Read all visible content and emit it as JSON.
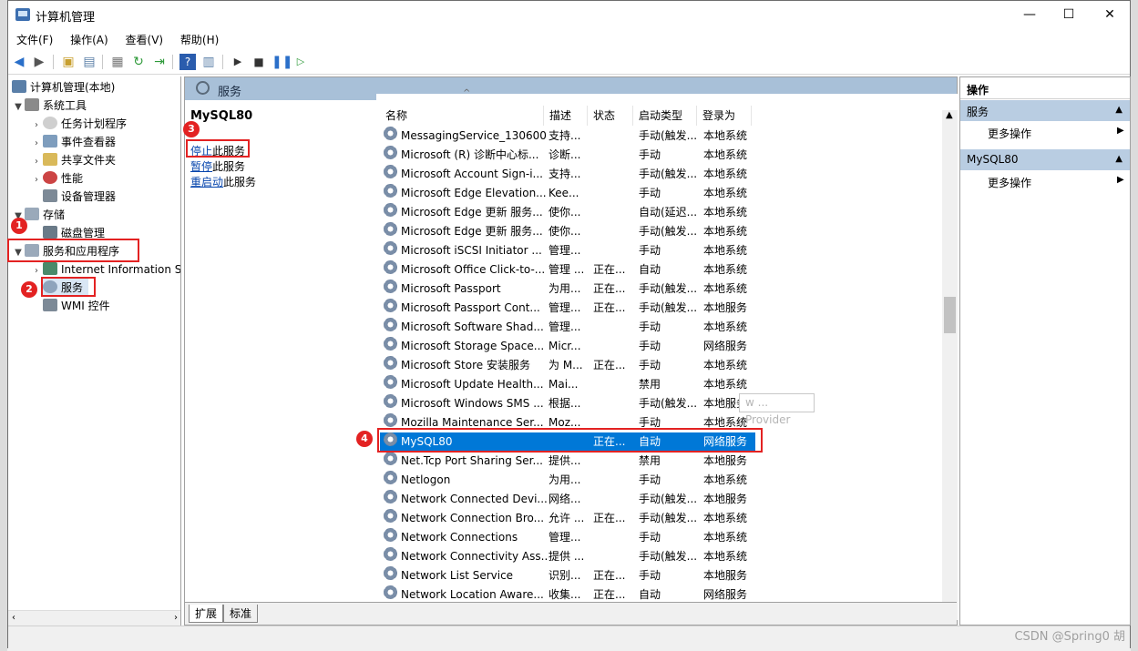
{
  "window": {
    "title": "计算机管理",
    "controls": {
      "minimize": "—",
      "maximize": "☐",
      "close": "✕"
    }
  },
  "menu": [
    "文件(F)",
    "操作(A)",
    "查看(V)",
    "帮助(H)"
  ],
  "tree": {
    "root": "计算机管理(本地)",
    "system_tools": "系统工具",
    "task_scheduler": "任务计划程序",
    "event_viewer": "事件查看器",
    "shared_folders": "共享文件夹",
    "performance": "性能",
    "device_manager": "设备管理器",
    "storage": "存储",
    "disk_management": "磁盘管理",
    "services_apps": "服务和应用程序",
    "iis": "Internet Information S",
    "services": "服务",
    "wmi": "WMI 控件"
  },
  "services_pane": {
    "header": "服务",
    "selected_name": "MySQL80",
    "stop_link": "停止",
    "stop_suffix": "此服务",
    "pause_link": "暂停",
    "pause_suffix": "此服务",
    "restart_link": "重启动",
    "restart_suffix": "此服务",
    "columns": {
      "name": "名称",
      "desc": "描述",
      "status": "状态",
      "startup": "启动类型",
      "logon": "登录为"
    },
    "rows": [
      {
        "name": "MessagingService_130600",
        "desc": "支持...",
        "status": "",
        "startup": "手动(触发...",
        "logon": "本地系统"
      },
      {
        "name": "Microsoft (R) 诊断中心标...",
        "desc": "诊断...",
        "status": "",
        "startup": "手动",
        "logon": "本地系统"
      },
      {
        "name": "Microsoft Account Sign-i...",
        "desc": "支持...",
        "status": "",
        "startup": "手动(触发...",
        "logon": "本地系统"
      },
      {
        "name": "Microsoft Edge Elevation...",
        "desc": "Kee...",
        "status": "",
        "startup": "手动",
        "logon": "本地系统"
      },
      {
        "name": "Microsoft Edge 更新 服务...",
        "desc": "使你...",
        "status": "",
        "startup": "自动(延迟...",
        "logon": "本地系统"
      },
      {
        "name": "Microsoft Edge 更新 服务...",
        "desc": "使你...",
        "status": "",
        "startup": "手动(触发...",
        "logon": "本地系统"
      },
      {
        "name": "Microsoft iSCSI Initiator ...",
        "desc": "管理...",
        "status": "",
        "startup": "手动",
        "logon": "本地系统"
      },
      {
        "name": "Microsoft Office Click-to-...",
        "desc": "管理 ...",
        "status": "正在...",
        "startup": "自动",
        "logon": "本地系统"
      },
      {
        "name": "Microsoft Passport",
        "desc": "为用...",
        "status": "正在...",
        "startup": "手动(触发...",
        "logon": "本地系统"
      },
      {
        "name": "Microsoft Passport Cont...",
        "desc": "管理...",
        "status": "正在...",
        "startup": "手动(触发...",
        "logon": "本地服务"
      },
      {
        "name": "Microsoft Software Shad...",
        "desc": "管理...",
        "status": "",
        "startup": "手动",
        "logon": "本地系统"
      },
      {
        "name": "Microsoft Storage Space...",
        "desc": "Micr...",
        "status": "",
        "startup": "手动",
        "logon": "网络服务"
      },
      {
        "name": "Microsoft Store 安装服务",
        "desc": "为 M...",
        "status": "正在...",
        "startup": "手动",
        "logon": "本地系统"
      },
      {
        "name": "Microsoft Update Health...",
        "desc": "Mai...",
        "status": "",
        "startup": "禁用",
        "logon": "本地系统"
      },
      {
        "name": "Microsoft Windows SMS ...",
        "desc": "根据...",
        "status": "",
        "startup": "手动(触发...",
        "logon": "本地服务"
      },
      {
        "name": "Mozilla Maintenance Ser...",
        "desc": "Moz...",
        "status": "",
        "startup": "手动",
        "logon": "本地系统"
      },
      {
        "name": "MySQL80",
        "desc": "",
        "status": "正在...",
        "startup": "自动",
        "logon": "网络服务",
        "selected": true
      },
      {
        "name": "Net.Tcp Port Sharing Ser...",
        "desc": "提供...",
        "status": "",
        "startup": "禁用",
        "logon": "本地服务"
      },
      {
        "name": "Netlogon",
        "desc": "为用...",
        "status": "",
        "startup": "手动",
        "logon": "本地系统"
      },
      {
        "name": "Network Connected Devi...",
        "desc": "网络...",
        "status": "",
        "startup": "手动(触发...",
        "logon": "本地服务"
      },
      {
        "name": "Network Connection Bro...",
        "desc": "允许 ...",
        "status": "正在...",
        "startup": "手动(触发...",
        "logon": "本地系统"
      },
      {
        "name": "Network Connections",
        "desc": "管理...",
        "status": "",
        "startup": "手动",
        "logon": "本地系统"
      },
      {
        "name": "Network Connectivity Ass...",
        "desc": "提供 ...",
        "status": "",
        "startup": "手动(触发...",
        "logon": "本地系统"
      },
      {
        "name": "Network List Service",
        "desc": "识别...",
        "status": "正在...",
        "startup": "手动",
        "logon": "本地服务"
      },
      {
        "name": "Network Location Aware...",
        "desc": "收集...",
        "status": "正在...",
        "startup": "自动",
        "logon": "网络服务"
      }
    ],
    "tooltip": "w ... Provider",
    "tabs": [
      "扩展",
      "标准"
    ]
  },
  "actions": {
    "header": "操作",
    "section1": "服务",
    "section1_item": "更多操作",
    "section2": "MySQL80",
    "section2_item": "更多操作"
  },
  "annotations": [
    "1",
    "2",
    "3",
    "4"
  ],
  "watermark": "CSDN @Spring0 胡",
  "colors": {
    "selection": "#0078d7",
    "annotation": "#e32222",
    "header": "#a8c0d8"
  }
}
